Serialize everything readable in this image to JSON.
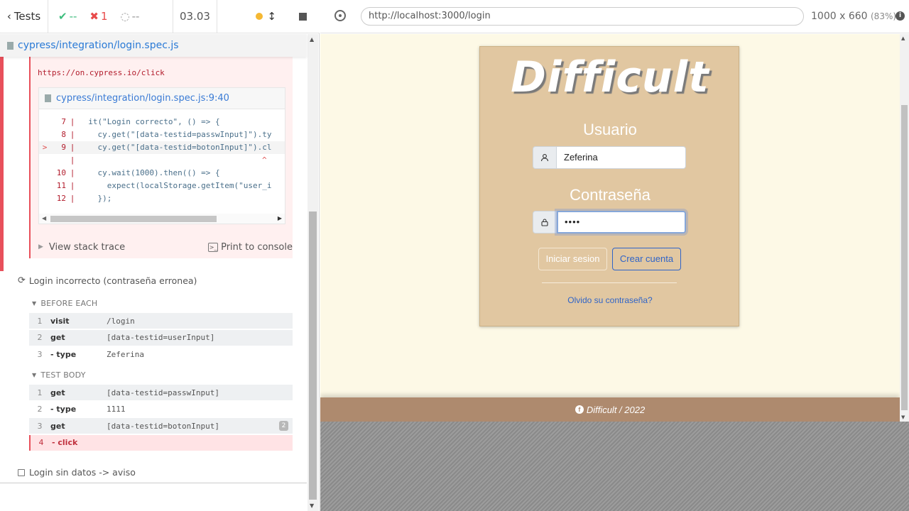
{
  "header": {
    "tests_label": "Tests",
    "passed": "--",
    "failed": "1",
    "pending": "--",
    "duration": "03.03"
  },
  "spec": {
    "path": "cypress/integration/login.spec.js"
  },
  "error": {
    "url": "https://on.cypress.io/click",
    "code_file": "cypress/integration/login.spec.js:9:40",
    "code_lines": [
      {
        "arrow": "",
        "num": "7",
        "text": "  it(\"Login correcto\", () => {"
      },
      {
        "arrow": "",
        "num": "8",
        "text": "    cy.get(\"[data-testid=passwInput]\").ty"
      },
      {
        "arrow": ">",
        "num": "9",
        "text": "    cy.get(\"[data-testid=botonInput]\").cl"
      },
      {
        "arrow": "",
        "num": "",
        "text": "^"
      },
      {
        "arrow": "",
        "num": "10",
        "text": "    cy.wait(1000).then(() => {"
      },
      {
        "arrow": "",
        "num": "11",
        "text": "      expect(localStorage.getItem(\"user_i"
      },
      {
        "arrow": "",
        "num": "12",
        "text": "    });"
      }
    ],
    "view_stack": "View stack trace",
    "print_console": "Print to console"
  },
  "test2": {
    "title": "Login incorrecto (contraseña erronea)",
    "before_each_label": "BEFORE EACH",
    "before_each": [
      {
        "n": "1",
        "cmd": "visit",
        "arg": "/login"
      },
      {
        "n": "2",
        "cmd": "get",
        "arg": "[data-testid=userInput]"
      },
      {
        "n": "3",
        "cmd": "- type",
        "arg": "Zeferina"
      }
    ],
    "test_body_label": "TEST BODY",
    "test_body": [
      {
        "n": "1",
        "cmd": "get",
        "arg": "[data-testid=passwInput]"
      },
      {
        "n": "2",
        "cmd": "- type",
        "arg": "1111"
      },
      {
        "n": "3",
        "cmd": "get",
        "arg": "[data-testid=botonInput]",
        "badge": "2"
      },
      {
        "n": "4",
        "cmd": "- click",
        "arg": ""
      }
    ]
  },
  "test3": {
    "title": "Login sin datos -> aviso"
  },
  "aut": {
    "url": "http://localhost:3000/login",
    "viewport": "1000 x 660",
    "zoom": "(83%)"
  },
  "app": {
    "brand": "Difficult",
    "user_label": "Usuario",
    "user_value": "Zeferina",
    "pass_label": "Contraseña",
    "pass_value": "••••",
    "login_button": "Iniciar sesion",
    "create_button": "Crear cuenta",
    "forgot_link": "Olvido su contraseña?",
    "footer": "Difficult / 2022"
  }
}
